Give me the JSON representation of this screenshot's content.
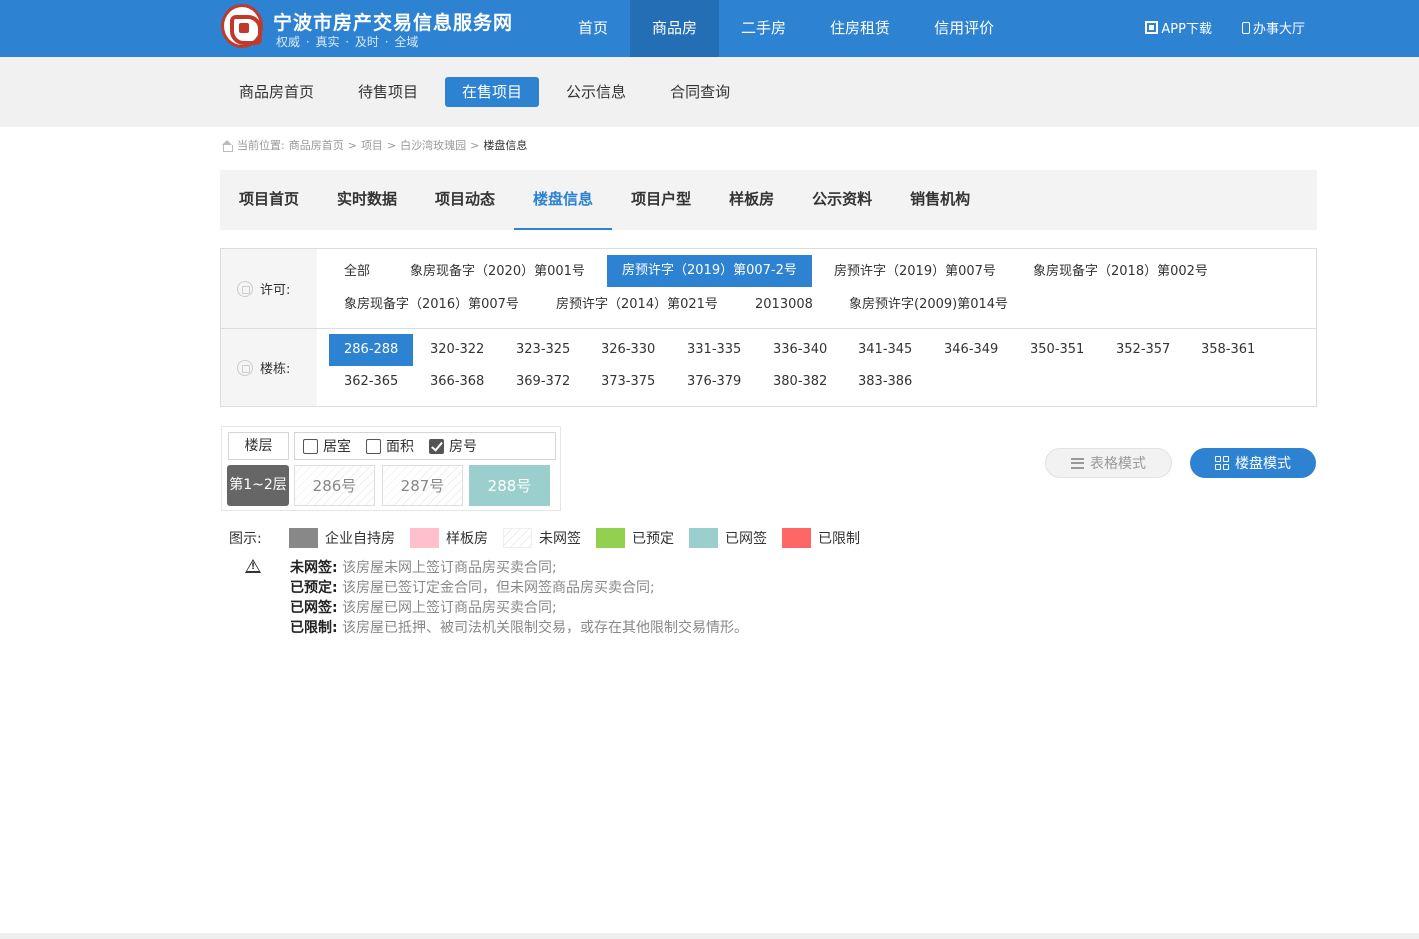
{
  "header": {
    "site_title": "宁波市房产交易信息服务网",
    "site_slogan": "权威 · 真实 · 及时 · 全域",
    "nav": [
      {
        "label": "首页",
        "active": false
      },
      {
        "label": "商品房",
        "active": true
      },
      {
        "label": "二手房",
        "active": false
      },
      {
        "label": "住房租赁",
        "active": false
      },
      {
        "label": "信用评价",
        "active": false
      }
    ],
    "app_download": "APP下载",
    "service_hall": "办事大厅"
  },
  "subnav": [
    {
      "label": "商品房首页",
      "active": false
    },
    {
      "label": "待售项目",
      "active": false
    },
    {
      "label": "在售项目",
      "active": true
    },
    {
      "label": "公示信息",
      "active": false
    },
    {
      "label": "合同查询",
      "active": false
    }
  ],
  "breadcrumb": {
    "prefix": "当前位置:",
    "items": [
      "商品房首页",
      "项目",
      "白沙湾玫瑰园"
    ],
    "separator": ">",
    "current": "楼盘信息"
  },
  "project_tabs": [
    {
      "label": "项目首页",
      "active": false
    },
    {
      "label": "实时数据",
      "active": false
    },
    {
      "label": "项目动态",
      "active": false
    },
    {
      "label": "楼盘信息",
      "active": true
    },
    {
      "label": "项目户型",
      "active": false
    },
    {
      "label": "样板房",
      "active": false
    },
    {
      "label": "公示资料",
      "active": false
    },
    {
      "label": "销售机构",
      "active": false
    }
  ],
  "filters": {
    "permit_label": "许可:",
    "permits": [
      {
        "label": "全部",
        "active": false
      },
      {
        "label": "象房现备字（2020）第001号",
        "active": false
      },
      {
        "label": "房预许字（2019）第007-2号",
        "active": true
      },
      {
        "label": "房预许字（2019）第007号",
        "active": false
      },
      {
        "label": "象房现备字（2018）第002号",
        "active": false
      },
      {
        "label": "象房现备字（2016）第007号",
        "active": false
      },
      {
        "label": "房预许字（2014）第021号",
        "active": false
      },
      {
        "label": "2013008",
        "active": false
      },
      {
        "label": "象房预许字(2009)第014号",
        "active": false
      }
    ],
    "building_label": "楼栋:",
    "buildings": [
      {
        "label": "286-288",
        "active": true
      },
      {
        "label": "320-322",
        "active": false
      },
      {
        "label": "323-325",
        "active": false
      },
      {
        "label": "326-330",
        "active": false
      },
      {
        "label": "331-335",
        "active": false
      },
      {
        "label": "336-340",
        "active": false
      },
      {
        "label": "341-345",
        "active": false
      },
      {
        "label": "346-349",
        "active": false
      },
      {
        "label": "350-351",
        "active": false
      },
      {
        "label": "352-357",
        "active": false
      },
      {
        "label": "358-361",
        "active": false
      },
      {
        "label": "362-365",
        "active": false
      },
      {
        "label": "366-368",
        "active": false
      },
      {
        "label": "369-372",
        "active": false
      },
      {
        "label": "373-375",
        "active": false
      },
      {
        "label": "376-379",
        "active": false
      },
      {
        "label": "380-382",
        "active": false
      },
      {
        "label": "383-386",
        "active": false
      }
    ]
  },
  "floor_table": {
    "floor_header": "楼层",
    "options": [
      {
        "label": "居室",
        "checked": false
      },
      {
        "label": "面积",
        "checked": false
      },
      {
        "label": "房号",
        "checked": true
      }
    ],
    "floor_label": "第1~2层",
    "rooms": [
      {
        "label": "286号",
        "status": "未网签"
      },
      {
        "label": "287号",
        "status": "未网签"
      },
      {
        "label": "288号",
        "status": "已网签"
      }
    ]
  },
  "view_modes": {
    "table_label": "表格模式",
    "grid_label": "楼盘模式"
  },
  "legend": {
    "label": "图示:",
    "items": [
      {
        "label": "企业自持房",
        "color": "#888888"
      },
      {
        "label": "样板房",
        "color": "#ffc0cb"
      },
      {
        "label": "未网签",
        "color": "striped"
      },
      {
        "label": "已预定",
        "color": "#92d050"
      },
      {
        "label": "已网签",
        "color": "#9bcfcd"
      },
      {
        "label": "已限制",
        "color": "#ff6666"
      }
    ]
  },
  "notes": [
    {
      "term": "未网签:",
      "desc": "该房屋未网上签订商品房买卖合同;"
    },
    {
      "term": "已预定:",
      "desc": "该房屋已签订定金合同，但未网签商品房买卖合同;"
    },
    {
      "term": "已网签:",
      "desc": "该房屋已网上签订商品房买卖合同;"
    },
    {
      "term": "已限制:",
      "desc": "该房屋已抵押、被司法机关限制交易，或存在其他限制交易情形。"
    }
  ]
}
